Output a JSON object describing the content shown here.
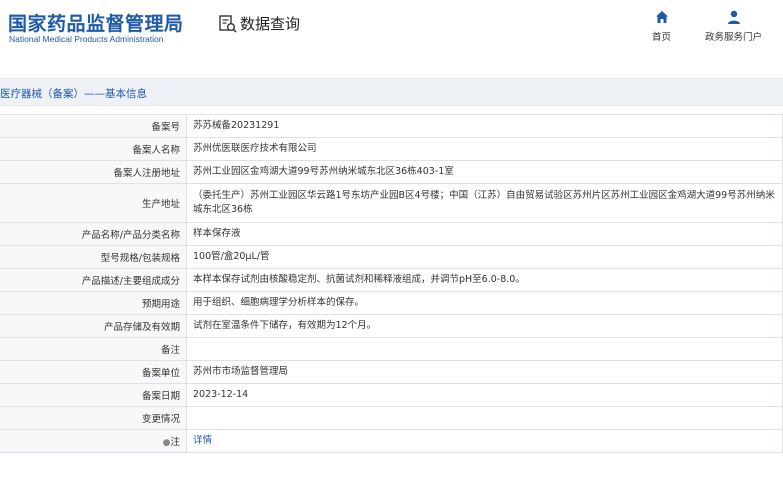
{
  "header": {
    "logo_cn": "国家药品监督管理局",
    "logo_en": "National Medical Products Administration",
    "query_label": "数据查询",
    "nav": {
      "home": "首页",
      "portal": "政务服务门户"
    }
  },
  "breadcrumb": "医疗器械（备案）——基本信息",
  "rows": [
    {
      "label": "备案号",
      "value": "苏苏械备20231291"
    },
    {
      "label": "备案人名称",
      "value": "苏州优医联医疗技术有限公司"
    },
    {
      "label": "备案人注册地址",
      "value": "苏州工业园区金鸡湖大道99号苏州纳米城东北区36栋403-1室"
    },
    {
      "label": "生产地址",
      "value": "（委托生产）苏州工业园区华云路1号东坊产业园B区4号楼；中国（江苏）自由贸易试验区苏州片区苏州工业园区金鸡湖大道99号苏州纳米城东北区36栋"
    },
    {
      "label": "产品名称/产品分类名称",
      "value": "样本保存液"
    },
    {
      "label": "型号规格/包装规格",
      "value": "100管/盒20μL/管"
    },
    {
      "label": "产品描述/主要组成成分",
      "value": "本样本保存试剂由核酸稳定剂、抗菌试剂和稀释液组成，并调节pH至6.0-8.0。"
    },
    {
      "label": "预期用途",
      "value": "用于组织、细胞病理学分析样本的保存。"
    },
    {
      "label": "产品存储及有效期",
      "value": "试剂在室温条件下储存，有效期为12个月。"
    },
    {
      "label": "备注",
      "value": ""
    },
    {
      "label": "备案单位",
      "value": "苏州市市场监督管理局"
    },
    {
      "label": "备案日期",
      "value": "2023-12-14"
    },
    {
      "label": "变更情况",
      "value": ""
    },
    {
      "label": "注",
      "value": "详情"
    }
  ],
  "colors": {
    "brand_blue": "#1e5aa8",
    "label_bg": "#f7f8fa",
    "crumb_bg": "#eef1f5"
  }
}
